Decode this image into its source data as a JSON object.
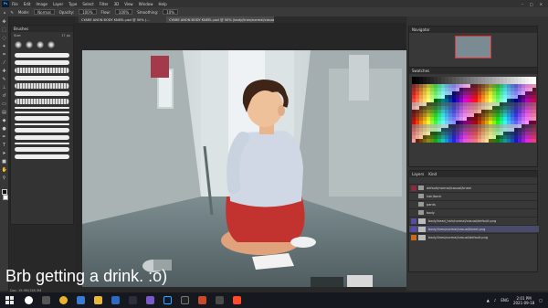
{
  "menubar": {
    "app_logo": "Ps",
    "items": [
      "File",
      "Edit",
      "Image",
      "Layer",
      "Type",
      "Select",
      "Filter",
      "3D",
      "View",
      "Window",
      "Help"
    ]
  },
  "optionsbar": {
    "mode_label": "Mode:",
    "mode_value": "Normal",
    "opacity_label": "Opacity:",
    "opacity_value": "100%",
    "flow_label": "Flow:",
    "flow_value": "100%",
    "smoothing_label": "Smoothing:",
    "smoothing_value": "10%"
  },
  "tabs": [
    {
      "label": "CYARE ANON BODY KNEEL.psd @ 50% (..."
    },
    {
      "label": "CYARE ANON BODY KNEEL.psd @ 50% (body/lines/normal/casual/kneel.png, RGB/8*)"
    }
  ],
  "brushes": {
    "title": "Brushes",
    "size_label": "Size:",
    "size_value": "17 px"
  },
  "navigator": {
    "title": "Navigator",
    "zoom": "50%"
  },
  "swatches": {
    "title": "Swatches"
  },
  "layers": {
    "title": "Layers",
    "filter": "Kind",
    "rows": [
      {
        "name": "default/normal/casual/kneel",
        "eye": "red"
      },
      {
        "name": "hair/back",
        "eye": "none"
      },
      {
        "name": "pants",
        "eye": "none"
      },
      {
        "name": "body",
        "eye": "none"
      },
      {
        "name": "body/head_hair/normal/casual/default.png",
        "eye": "blue"
      },
      {
        "name": "body/lines/normal/casual/kneel.png",
        "eye": "blue"
      },
      {
        "name": "body/lines/normal/casual/default.png",
        "eye": "orange"
      }
    ]
  },
  "caption": "Brb getting a drink. :o)",
  "status": "Doc: 19.9M/158.3M",
  "taskbar": {
    "clock_time": "2:01 PM",
    "clock_date": "2021-09-18",
    "lang": "ENG"
  },
  "colors": {
    "accent_red": "#d42a3a",
    "layer_selected": "#4a4a6a"
  }
}
